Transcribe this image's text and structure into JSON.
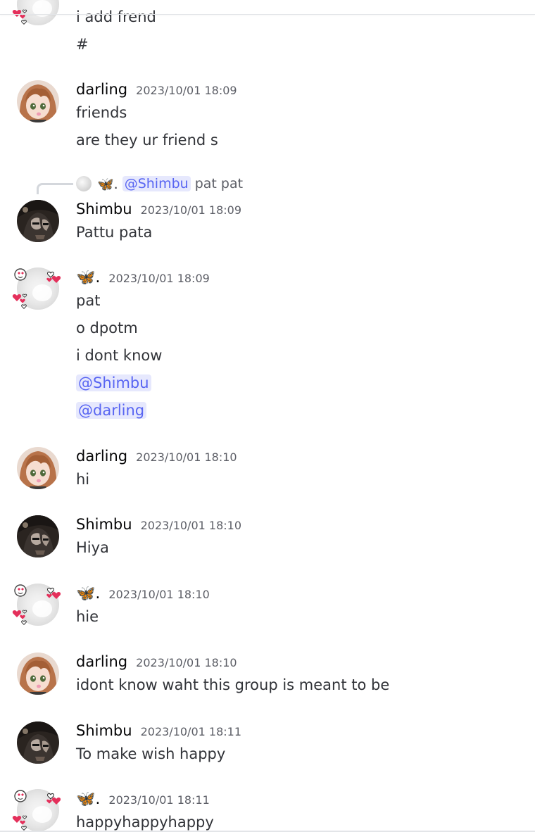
{
  "users": {
    "darling": "darling",
    "shimbu": "Shimbu",
    "butterfly": "🦋."
  },
  "messages": {
    "m0": {
      "lines": [
        "i add frend",
        "#"
      ]
    },
    "m1": {
      "timestamp": "2023/10/01 18:09",
      "lines": [
        "friends",
        "are they ur friend s"
      ]
    },
    "m2": {
      "reply": {
        "name": "🦋.",
        "mention": "@Shimbu",
        "text": "pat pat"
      },
      "timestamp": "2023/10/01 18:09",
      "lines": [
        "Pattu pata"
      ]
    },
    "m3": {
      "timestamp": "2023/10/01 18:09",
      "lines": [
        "pat",
        "o dpotm",
        "i dont know"
      ],
      "mentions": [
        "@Shimbu",
        "@darling"
      ]
    },
    "m4": {
      "timestamp": "2023/10/01 18:10",
      "lines": [
        "hi"
      ]
    },
    "m5": {
      "timestamp": "2023/10/01 18:10",
      "lines": [
        "Hiya"
      ]
    },
    "m6": {
      "timestamp": "2023/10/01 18:10",
      "lines": [
        "hie"
      ]
    },
    "m7": {
      "timestamp": "2023/10/01 18:10",
      "lines": [
        "idont know waht this group is meant to be"
      ]
    },
    "m8": {
      "timestamp": "2023/10/01 18:11",
      "lines": [
        "To make wish happy"
      ]
    },
    "m9": {
      "timestamp": "2023/10/01 18:11",
      "lines": [
        "happyhappyhappy"
      ]
    }
  },
  "colors": {
    "mention_bg": "#e6e8fd",
    "mention_fg": "#5865f2",
    "text": "#313338",
    "timestamp": "#5c5e66"
  }
}
